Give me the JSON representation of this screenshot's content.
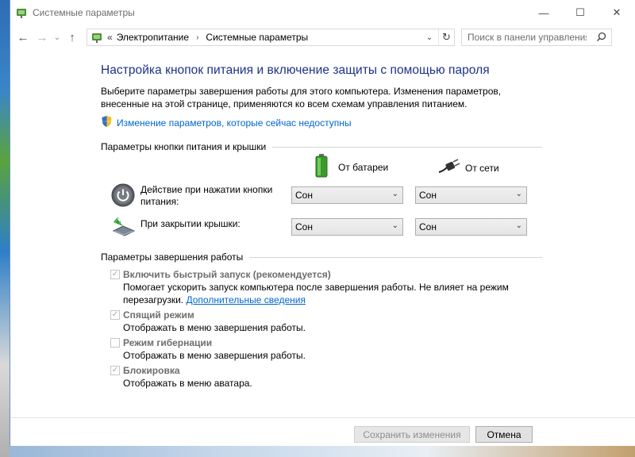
{
  "window": {
    "title": "Системные параметры",
    "controls": {
      "minimize": "—",
      "maximize": "☐",
      "close": "✕"
    }
  },
  "nav": {
    "back": "←",
    "forward": "→",
    "recent": "⌄",
    "up": "↑",
    "breadcrumb_prefix": "«",
    "breadcrumb": [
      "Электропитание",
      "Системные параметры"
    ],
    "crumb_separator": "›",
    "address_dropdown": "⌄",
    "refresh": "↻",
    "search_placeholder": "Поиск в панели управления"
  },
  "page": {
    "heading": "Настройка кнопок питания и включение защиты с помощью пароля",
    "intro": "Выберите параметры завершения работы для этого компьютера. Изменения параметров, внесенные на этой странице, применяются ко всем схемам управления питанием.",
    "admin_link": "Изменение параметров, которые сейчас недоступны"
  },
  "power_group": {
    "title": "Параметры кнопки питания и крышки",
    "col_battery": "От батареи",
    "col_ac": "От сети",
    "rows": [
      {
        "label": "Действие при нажатии кнопки питания:",
        "battery": "Сон",
        "ac": "Сон"
      },
      {
        "label": "При закрытии крышки:",
        "battery": "Сон",
        "ac": "Сон"
      }
    ]
  },
  "shutdown_group": {
    "title": "Параметры завершения работы",
    "items": [
      {
        "title": "Включить быстрый запуск (рекомендуется)",
        "checked": true,
        "desc": "Помогает ускорить запуск компьютера после завершения работы. Не влияет на режим перезагрузки.",
        "link": "Дополнительные сведения"
      },
      {
        "title": "Спящий режим",
        "checked": true,
        "desc": "Отображать в меню завершения работы."
      },
      {
        "title": "Режим гибернации",
        "checked": false,
        "desc": "Отображать в меню завершения работы."
      },
      {
        "title": "Блокировка",
        "checked": true,
        "desc": "Отображать в меню аватара."
      }
    ]
  },
  "footer": {
    "save": "Сохранить изменения",
    "cancel": "Отмена"
  },
  "colors": {
    "heading": "#1e3287",
    "link": "#0066cc",
    "disabled_text": "#6d6d6d"
  },
  "icons": {
    "title": "power-options-icon",
    "address": "power-options-icon",
    "search": "search-icon",
    "shield": "uac-shield-icon",
    "battery": "battery-icon",
    "plug": "power-plug-icon",
    "power_button": "power-button-icon",
    "lid": "laptop-lid-icon"
  }
}
